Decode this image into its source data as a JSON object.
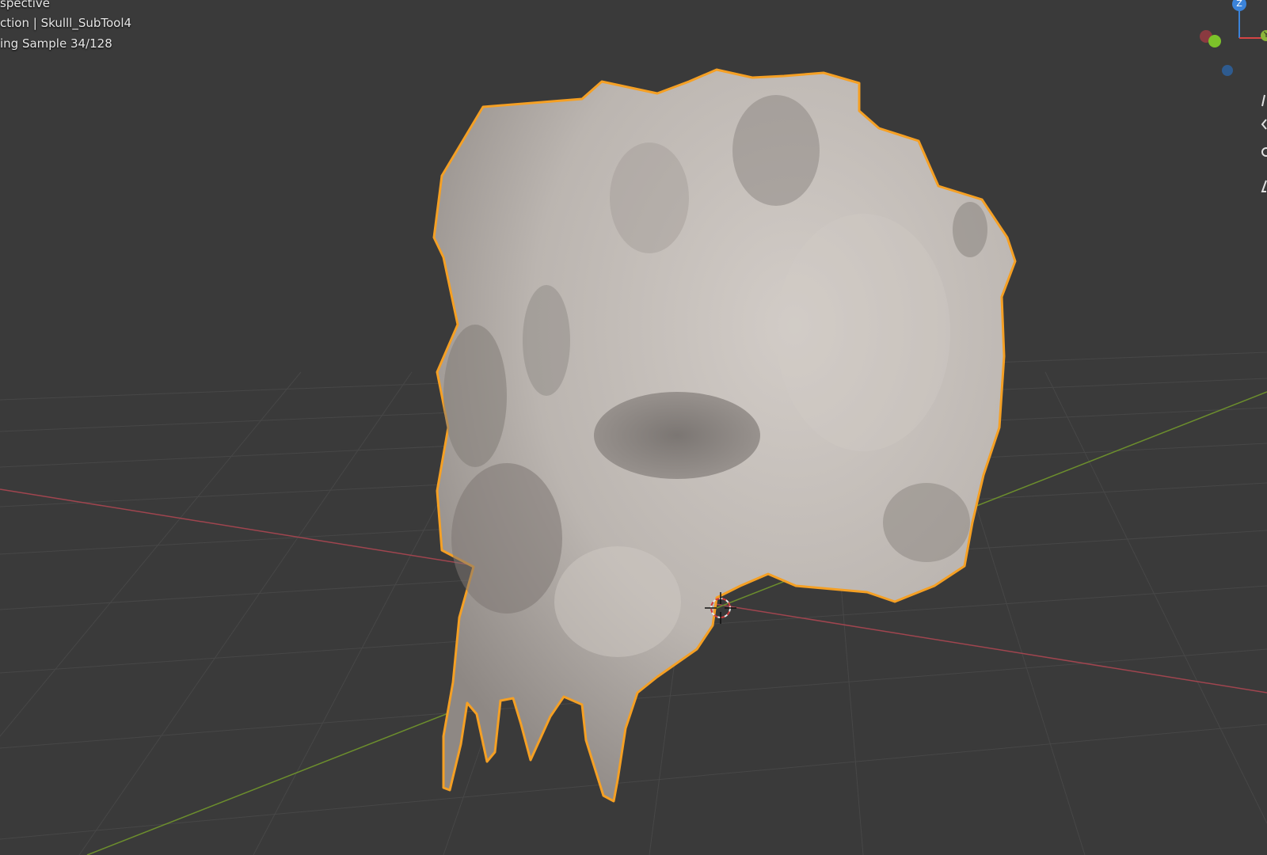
{
  "viewport": {
    "view_mode": "spective",
    "collection_object": "ction | Skulll_SubTool4",
    "render_status": "ing Sample 34/128"
  },
  "colors": {
    "background": "#3a3a3a",
    "grid": "#484848",
    "x_axis": "#a0454f",
    "y_axis": "#6c8e2d",
    "selection_outline": "#f5a024",
    "mesh": "#c3bdb8"
  },
  "gizmo": {
    "z_label": "Z",
    "y_label": "Y"
  },
  "icons": [
    "view-gizmo-icon",
    "3d-cursor-icon"
  ]
}
